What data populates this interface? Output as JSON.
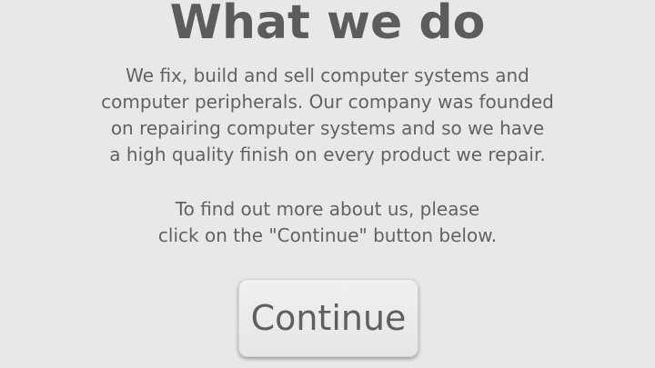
{
  "heading": "What we do",
  "paragraph1": {
    "lines": [
      "We fix, build and sell computer systems and",
      "computer peripherals. Our company was founded",
      "on repairing computer systems and so we have",
      "a high quality finish on every product we repair."
    ]
  },
  "paragraph2": {
    "lines": [
      "To find out more about us, please",
      "click on the \"Continue\" button below."
    ]
  },
  "continue_button": {
    "label": "Continue"
  },
  "colors": {
    "background": "#e8e8e8",
    "text": "#5f5f5f"
  }
}
